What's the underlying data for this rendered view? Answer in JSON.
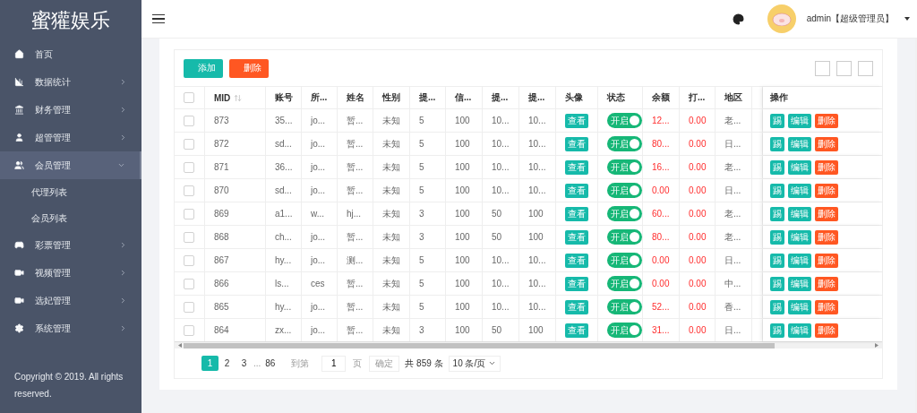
{
  "sidebar": {
    "logo": "蜜獾娱乐",
    "items": [
      {
        "kind": "home",
        "label": "首页",
        "selected": false
      },
      {
        "kind": "chart",
        "label": "数据统计",
        "expanded": false,
        "selected": false
      },
      {
        "kind": "bank",
        "label": "财务管理",
        "expanded": false,
        "selected": false
      },
      {
        "kind": "user",
        "label": "超管管理",
        "expanded": false,
        "selected": false
      },
      {
        "kind": "users",
        "label": "会员管理",
        "expanded": true,
        "selected": true,
        "children": [
          {
            "label": "代理列表"
          },
          {
            "label": "会员列表"
          }
        ]
      },
      {
        "kind": "game",
        "label": "彩票管理",
        "expanded": false,
        "selected": false
      },
      {
        "kind": "video",
        "label": "视频管理",
        "expanded": false,
        "selected": false
      },
      {
        "kind": "video",
        "label": "选妃管理",
        "expanded": false,
        "selected": false
      },
      {
        "kind": "settings",
        "label": "系统管理",
        "expanded": false,
        "selected": false
      }
    ],
    "copyright": "Copyright © 2019. All rights reserved."
  },
  "header": {
    "user": "admin【超级管理员】"
  },
  "toolbar": {
    "buttons": [
      {
        "label": "添加",
        "kind": "primary"
      },
      {
        "label": "删除",
        "kind": "danger"
      }
    ]
  },
  "table": {
    "all_checked": false,
    "columns": [
      "MID",
      "账号",
      "所...",
      "姓名",
      "性别",
      "提...",
      "信...",
      "提...",
      "提...",
      "头像",
      "状态",
      "余额",
      "打...",
      "地区",
      "操作"
    ],
    "rows": [
      {
        "checked": false,
        "cells": [
          "873",
          "35...",
          "jo...",
          "暂...",
          "未知",
          "5",
          "100",
          "10...",
          "10..."
        ],
        "avatar": "查看",
        "status": "开启",
        "on": true,
        "balance": "12...",
        "bet": "0.00",
        "region": "老...",
        "actions": [
          "踢",
          "编辑",
          "删除"
        ]
      },
      {
        "checked": false,
        "cells": [
          "872",
          "sd...",
          "jo...",
          "暂...",
          "未知",
          "5",
          "100",
          "10...",
          "10..."
        ],
        "avatar": "查看",
        "status": "开启",
        "on": true,
        "balance": "80...",
        "bet": "0.00",
        "region": "日...",
        "actions": [
          "踢",
          "编辑",
          "删除"
        ]
      },
      {
        "checked": false,
        "cells": [
          "871",
          "36...",
          "jo...",
          "暂...",
          "未知",
          "5",
          "100",
          "10...",
          "10..."
        ],
        "avatar": "查看",
        "status": "开启",
        "on": true,
        "balance": "16...",
        "bet": "0.00",
        "region": "老...",
        "actions": [
          "踢",
          "编辑",
          "删除"
        ]
      },
      {
        "checked": false,
        "cells": [
          "870",
          "sd...",
          "jo...",
          "暂...",
          "未知",
          "5",
          "100",
          "10...",
          "10..."
        ],
        "avatar": "查看",
        "status": "开启",
        "on": true,
        "balance": "0.00",
        "bet": "0.00",
        "region": "日...",
        "actions": [
          "踢",
          "编辑",
          "删除"
        ]
      },
      {
        "checked": false,
        "cells": [
          "869",
          "a1...",
          "w...",
          "hj...",
          "未知",
          "3",
          "100",
          "50",
          "100"
        ],
        "avatar": "查看",
        "status": "开启",
        "on": true,
        "balance": "60...",
        "bet": "0.00",
        "region": "老...",
        "actions": [
          "踢",
          "编辑",
          "删除"
        ]
      },
      {
        "checked": false,
        "cells": [
          "868",
          "ch...",
          "jo...",
          "暂...",
          "未知",
          "3",
          "100",
          "50",
          "100"
        ],
        "avatar": "查看",
        "status": "开启",
        "on": true,
        "balance": "80...",
        "bet": "0.00",
        "region": "老...",
        "actions": [
          "踢",
          "编辑",
          "删除"
        ]
      },
      {
        "checked": false,
        "cells": [
          "867",
          "hy...",
          "jo...",
          "测...",
          "未知",
          "5",
          "100",
          "10...",
          "10..."
        ],
        "avatar": "查看",
        "status": "开启",
        "on": true,
        "balance": "0.00",
        "bet": "0.00",
        "region": "日...",
        "actions": [
          "踢",
          "编辑",
          "删除"
        ]
      },
      {
        "checked": false,
        "cells": [
          "866",
          "ls...",
          "ces",
          "暂...",
          "未知",
          "5",
          "100",
          "10...",
          "10..."
        ],
        "avatar": "查看",
        "status": "开启",
        "on": true,
        "balance": "0.00",
        "bet": "0.00",
        "region": "中...",
        "actions": [
          "踢",
          "编辑",
          "删除"
        ]
      },
      {
        "checked": false,
        "cells": [
          "865",
          "hy...",
          "jo...",
          "暂...",
          "未知",
          "5",
          "100",
          "10...",
          "10..."
        ],
        "avatar": "查看",
        "status": "开启",
        "on": true,
        "balance": "52...",
        "bet": "0.00",
        "region": "香...",
        "actions": [
          "踢",
          "编辑",
          "删除"
        ]
      },
      {
        "checked": false,
        "cells": [
          "864",
          "zx...",
          "jo...",
          "暂...",
          "未知",
          "3",
          "100",
          "50",
          "100"
        ],
        "avatar": "查看",
        "status": "开启",
        "on": true,
        "balance": "31...",
        "bet": "0.00",
        "region": "日...",
        "actions": [
          "踢",
          "编辑",
          "删除"
        ]
      }
    ]
  },
  "pagination": {
    "pages": [
      {
        "label": "1",
        "selected": true
      },
      {
        "label": "2",
        "selected": false
      },
      {
        "label": "3",
        "selected": false
      }
    ],
    "ellipsis": "...",
    "last": "86",
    "goto": "到第",
    "page_value": "1",
    "page_unit": "页",
    "confirm": "确定",
    "total": "共 859 条",
    "page_size": "10 条/页"
  }
}
